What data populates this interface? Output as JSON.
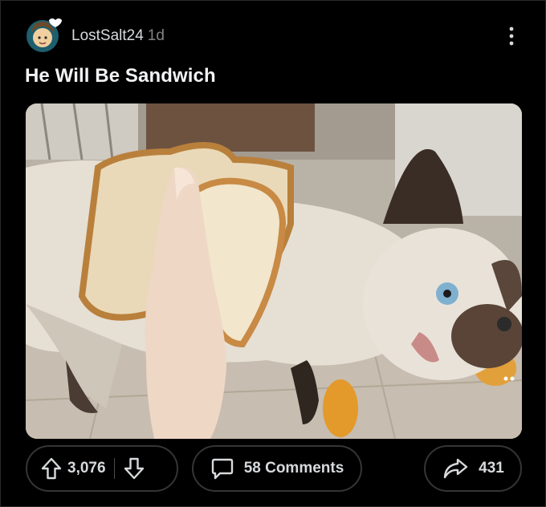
{
  "post": {
    "username": "LostSalt24",
    "age": "1d",
    "title": "He Will Be Sandwich",
    "image_alt": "Kitten held between two slices of bread"
  },
  "actions": {
    "upvotes": "3,076",
    "comments_label": "58 Comments",
    "shares": "431"
  },
  "icons": {
    "avatar": "avatar-icon",
    "more": "more-vertical-icon",
    "upvote": "arrow-up-icon",
    "downvote": "arrow-down-icon",
    "comments": "comment-bubble-icon",
    "share": "share-arrow-icon"
  },
  "colors": {
    "background": "#000000",
    "text": "#d7dadc",
    "muted": "#818384",
    "border": "#343536"
  }
}
